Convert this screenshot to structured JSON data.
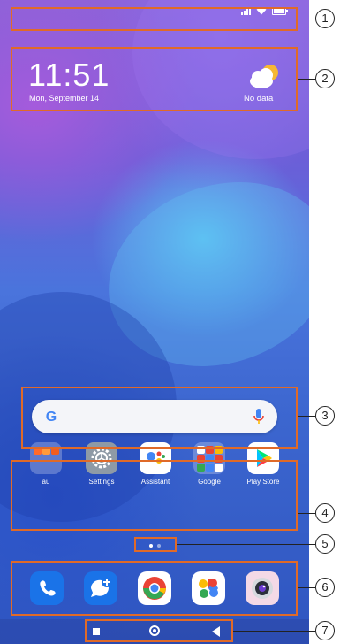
{
  "clock": {
    "time": "11:51",
    "date": "Mon, September 14"
  },
  "weather": {
    "status": "No data"
  },
  "search": {
    "logo": "G"
  },
  "apps": [
    {
      "label": "au",
      "icon": "au-folder-icon"
    },
    {
      "label": "Settings",
      "icon": "gear-icon"
    },
    {
      "label": "Assistant",
      "icon": "assistant-icon"
    },
    {
      "label": "Google",
      "icon": "google-folder-icon"
    },
    {
      "label": "Play Store",
      "icon": "play-store-icon"
    }
  ],
  "dock": [
    {
      "icon": "phone-icon"
    },
    {
      "icon": "messages-icon"
    },
    {
      "icon": "chrome-icon"
    },
    {
      "icon": "photos-icon"
    },
    {
      "icon": "camera-icon"
    }
  ],
  "callouts": [
    "1",
    "2",
    "3",
    "4",
    "5",
    "6",
    "7"
  ],
  "colors": {
    "annotation": "#e06a28",
    "accent_blue": "#1a73e8"
  }
}
